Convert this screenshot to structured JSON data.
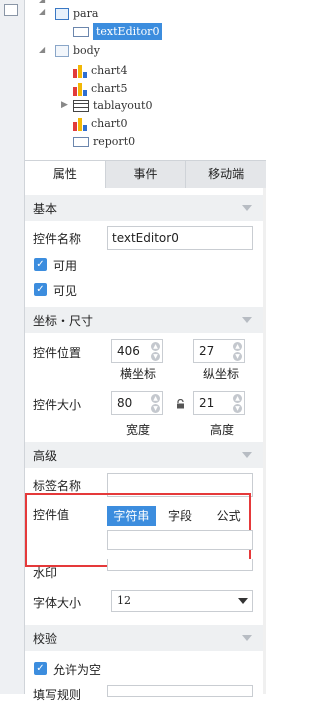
{
  "tree": {
    "nodes": [
      {
        "label": "para"
      },
      {
        "label": "textEditor0"
      },
      {
        "label": "body"
      },
      {
        "label": "chart4"
      },
      {
        "label": "chart5"
      },
      {
        "label": "tablayout0"
      },
      {
        "label": "chart0"
      },
      {
        "label": "report0"
      }
    ]
  },
  "tabs": [
    "属性",
    "事件",
    "移动端"
  ],
  "sections": {
    "basic": "基本",
    "coords": "坐标・尺寸",
    "advanced": "高级",
    "validate": "校验"
  },
  "basic": {
    "name_label": "控件名称",
    "name_value": "textEditor0",
    "enabled_label": "可用",
    "visible_label": "可见"
  },
  "coords": {
    "pos_label": "控件位置",
    "x_value": "406",
    "y_value": "27",
    "x_caption": "横坐标",
    "y_caption": "纵坐标",
    "size_label": "控件大小",
    "w_value": "80",
    "h_value": "21",
    "w_caption": "宽度",
    "h_caption": "高度"
  },
  "advanced": {
    "tag_label": "标签名称",
    "value_label": "控件值",
    "value_modes": [
      "字符串",
      "字段",
      "公式"
    ],
    "watermark_label": "水印",
    "fontsize_label": "字体大小",
    "fontsize_value": "12"
  },
  "validate": {
    "allow_empty_label": "允许为空",
    "rule_label": "填写规则"
  }
}
